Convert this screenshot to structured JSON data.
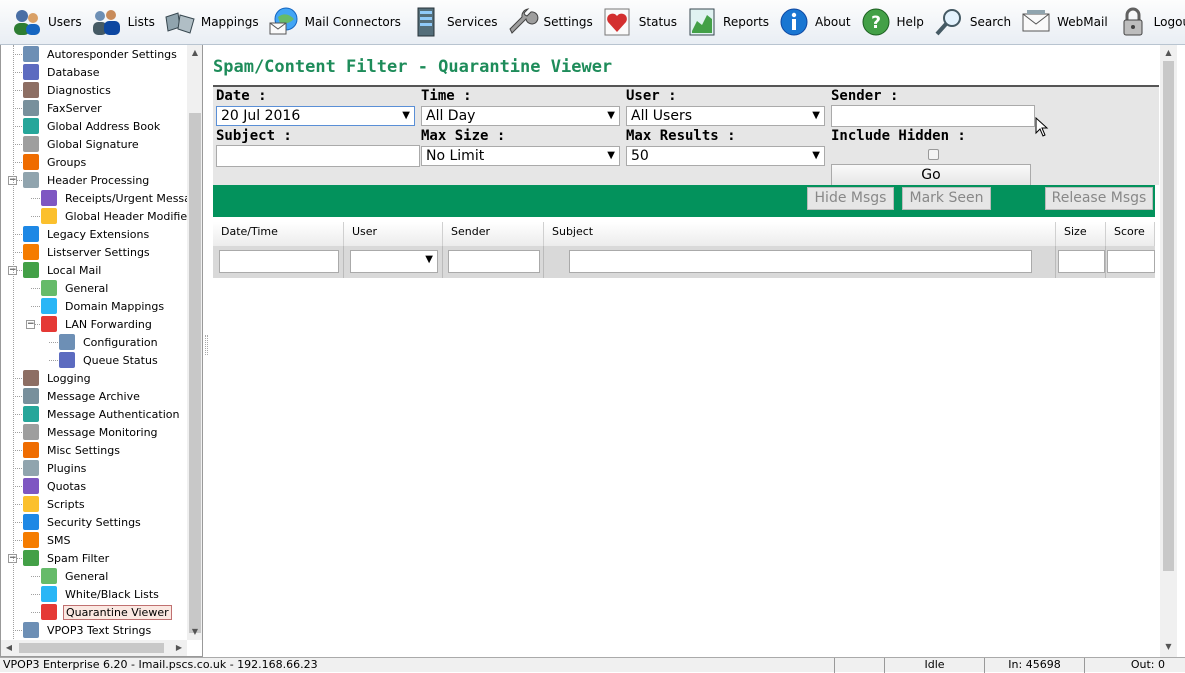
{
  "toolbar": {
    "items": [
      {
        "label": "Users",
        "icon": "users-icon"
      },
      {
        "label": "Lists",
        "icon": "lists-icon"
      },
      {
        "label": "Mappings",
        "icon": "mappings-icon"
      },
      {
        "label": "Mail Connectors",
        "icon": "mail-connectors-icon"
      },
      {
        "label": "Services",
        "icon": "services-icon"
      },
      {
        "label": "Settings",
        "icon": "settings-icon"
      },
      {
        "label": "Status",
        "icon": "status-icon"
      },
      {
        "label": "Reports",
        "icon": "reports-icon"
      },
      {
        "label": "About",
        "icon": "about-icon"
      },
      {
        "label": "Help",
        "icon": "help-icon"
      },
      {
        "label": "Search",
        "icon": "search-icon"
      },
      {
        "label": "WebMail",
        "icon": "webmail-icon"
      },
      {
        "label": "Logout",
        "icon": "logout-icon"
      }
    ]
  },
  "tree": {
    "items": [
      {
        "label": "Autoresponder Settings",
        "level": 0
      },
      {
        "label": "Database",
        "level": 0
      },
      {
        "label": "Diagnostics",
        "level": 0
      },
      {
        "label": "FaxServer",
        "level": 0
      },
      {
        "label": "Global Address Book",
        "level": 0
      },
      {
        "label": "Global Signature",
        "level": 0
      },
      {
        "label": "Groups",
        "level": 0
      },
      {
        "label": "Header Processing",
        "level": 0,
        "expander": "−"
      },
      {
        "label": "Receipts/Urgent Messages",
        "level": 1
      },
      {
        "label": "Global Header Modifiers",
        "level": 1
      },
      {
        "label": "Legacy Extensions",
        "level": 0
      },
      {
        "label": "Listserver Settings",
        "level": 0
      },
      {
        "label": "Local Mail",
        "level": 0,
        "expander": "−"
      },
      {
        "label": "General",
        "level": 1
      },
      {
        "label": "Domain Mappings",
        "level": 1
      },
      {
        "label": "LAN Forwarding",
        "level": 1,
        "expander": "−"
      },
      {
        "label": "Configuration",
        "level": 2
      },
      {
        "label": "Queue Status",
        "level": 2
      },
      {
        "label": "Logging",
        "level": 0
      },
      {
        "label": "Message Archive",
        "level": 0
      },
      {
        "label": "Message Authentication",
        "level": 0
      },
      {
        "label": "Message Monitoring",
        "level": 0
      },
      {
        "label": "Misc Settings",
        "level": 0
      },
      {
        "label": "Plugins",
        "level": 0
      },
      {
        "label": "Quotas",
        "level": 0
      },
      {
        "label": "Scripts",
        "level": 0
      },
      {
        "label": "Security Settings",
        "level": 0
      },
      {
        "label": "SMS",
        "level": 0
      },
      {
        "label": "Spam Filter",
        "level": 0,
        "expander": "−"
      },
      {
        "label": "General",
        "level": 1
      },
      {
        "label": "White/Black Lists",
        "level": 1
      },
      {
        "label": "Quarantine Viewer",
        "level": 1,
        "selected": true
      },
      {
        "label": "VPOP3 Text Strings",
        "level": 0
      }
    ]
  },
  "page": {
    "title": "Spam/Content Filter - Quarantine Viewer"
  },
  "filters": {
    "date_label": "Date :",
    "date_value": "20 Jul 2016",
    "time_label": "Time :",
    "time_value": "All Day",
    "user_label": "User :",
    "user_value": "All Users",
    "sender_label": "Sender :",
    "sender_value": "",
    "subject_label": "Subject :",
    "subject_value": "",
    "maxsize_label": "Max Size :",
    "maxsize_value": "No Limit",
    "maxresults_label": "Max Results :",
    "maxresults_value": "50",
    "include_hidden_label": "Include Hidden :",
    "go_label": "Go"
  },
  "actions": {
    "hide_label": "Hide Msgs",
    "seen_label": "Mark Seen",
    "release_label": "Release Msgs"
  },
  "table": {
    "columns": [
      "Date/Time",
      "User",
      "Sender",
      "Subject",
      "Size",
      "Score"
    ]
  },
  "status": {
    "app": "VPOP3 Enterprise 6.20 - Imail.pscs.co.uk - 192.168.66.23",
    "state": "Idle",
    "in": "In: 45698",
    "out": "Out: 0"
  },
  "colors": {
    "accent": "#1e8c5a",
    "action_bar": "#03925c"
  }
}
